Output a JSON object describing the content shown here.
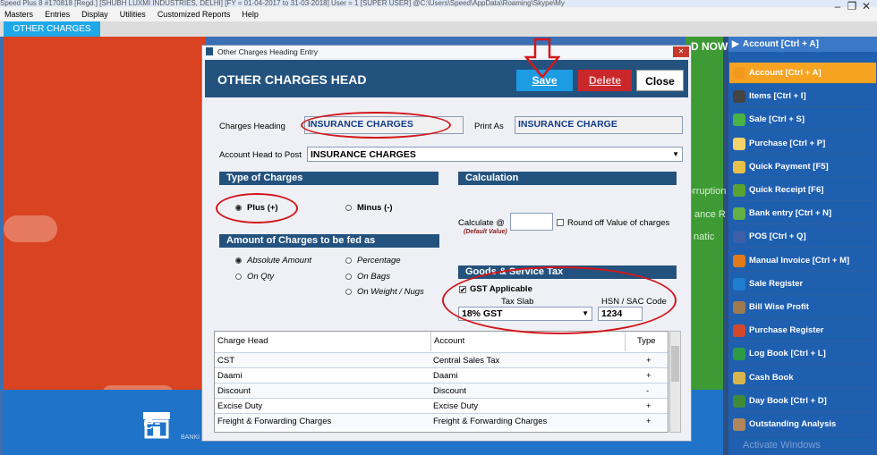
{
  "window": {
    "title": "Speed Plus 8 #170818 [Regd.] [SHUBH LUXMI INDUSTRIES, DELHI] [FY = 01-04-2017 to 31-03-2018] User = 1 [SUPER USER] @C:\\Users\\Speed\\AppData\\Roaming\\Skype\\My",
    "controls": [
      "–",
      "❐",
      "✕"
    ]
  },
  "menu": [
    "Masters",
    "Entries",
    "Display",
    "Utilities",
    "Customized Reports",
    "Help"
  ],
  "tab": {
    "label": "OTHER CHARGES"
  },
  "background": {
    "banner_partial": "D NOW",
    "text_lines": [
      "orruption",
      "ance R",
      "natic"
    ],
    "logo_text": "e-",
    "logo_sub": "BANKI"
  },
  "sidebar": {
    "header": "Account [Ctrl + A]",
    "items": [
      {
        "label": "Account [Ctrl + A]",
        "icon": "account-icon",
        "color": "#f39a1e"
      },
      {
        "label": "Items [Ctrl + I]",
        "icon": "items-icon",
        "color": "#444444"
      },
      {
        "label": "Sale [Ctrl + S]",
        "icon": "sale-icon",
        "color": "#49b347"
      },
      {
        "label": "Purchase [Ctrl + P]",
        "icon": "purchase-icon",
        "color": "#f2d36b"
      },
      {
        "label": "Quick Payment [F5]",
        "icon": "quick-payment-icon",
        "color": "#e8c14a"
      },
      {
        "label": "Quick Receipt [F6]",
        "icon": "quick-receipt-icon",
        "color": "#5aa332"
      },
      {
        "label": "Bank entry [Ctrl + N]",
        "icon": "bank-entry-icon",
        "color": "#63b045"
      },
      {
        "label": "POS [Ctrl + Q]",
        "icon": "pos-icon",
        "color": "#3c5fa8"
      },
      {
        "label": "Manual Invoice [Ctrl + M]",
        "icon": "manual-invoice-icon",
        "color": "#e07a1a"
      },
      {
        "label": "Sale Register",
        "icon": "sale-register-icon",
        "color": "#1e7ed1"
      },
      {
        "label": "Bill Wise Profit",
        "icon": "bill-wise-profit-icon",
        "color": "#9e7b4f"
      },
      {
        "label": "Purchase Register",
        "icon": "purchase-register-icon",
        "color": "#d1482c"
      },
      {
        "label": "Log Book [Ctrl + L]",
        "icon": "log-book-icon",
        "color": "#2f9a45"
      },
      {
        "label": "Cash Book",
        "icon": "cash-book-icon",
        "color": "#d9b54d"
      },
      {
        "label": "Day Book [Ctrl + D]",
        "icon": "day-book-icon",
        "color": "#3f8b3a"
      },
      {
        "label": "Outstanding Analysis",
        "icon": "outstanding-analysis-icon",
        "color": "#b1865b"
      }
    ],
    "footer_watermark": "Activate Windows"
  },
  "dialog": {
    "window_title": "Other Charges Heading Entry",
    "heading": "OTHER CHARGES HEAD",
    "buttons": {
      "save": "Save",
      "delete": "Delete",
      "close": "Close"
    },
    "charges_heading_label": "Charges Heading",
    "charges_heading_value": "INSURANCE CHARGES",
    "print_as_label": "Print As",
    "print_as_value": "INSURANCE CHARGE",
    "account_head_label": "Account Head to Post",
    "account_head_value": "INSURANCE CHARGES",
    "type_of_charges": {
      "title": "Type of Charges",
      "plus": "Plus (+)",
      "minus": "Minus (-)",
      "selected": "plus"
    },
    "calculation": {
      "title": "Calculation",
      "calculate_label": "Calculate @",
      "default_hint": "(Default Value)",
      "calculate_value": "",
      "round_off_label": "Round off Value of charges"
    },
    "amount": {
      "title": "Amount of Charges to be fed as",
      "options": [
        "Absolute Amount",
        "Percentage",
        "On Qty",
        "On Bags",
        "On Weight / Nugs"
      ],
      "selected": "Absolute Amount"
    },
    "gst": {
      "title": "Goods & Service Tax",
      "applicable_label": "GST Applicable",
      "applicable_checked": true,
      "tax_slab_label": "Tax Slab",
      "tax_slab_value": "18% GST",
      "hsn_label": "HSN / SAC Code",
      "hsn_value": "1234"
    },
    "table": {
      "headers": [
        "Charge Head",
        "Account",
        "Type"
      ],
      "rows": [
        [
          "CST",
          "Central Sales Tax",
          "+"
        ],
        [
          "Daami",
          "Daami",
          "+"
        ],
        [
          "Discount",
          "Discount",
          "-"
        ],
        [
          "Excise Duty",
          "Excise Duty",
          "+"
        ],
        [
          "Freight & Forwarding Charges",
          "Freight & Forwarding Charges",
          "+"
        ]
      ]
    }
  }
}
